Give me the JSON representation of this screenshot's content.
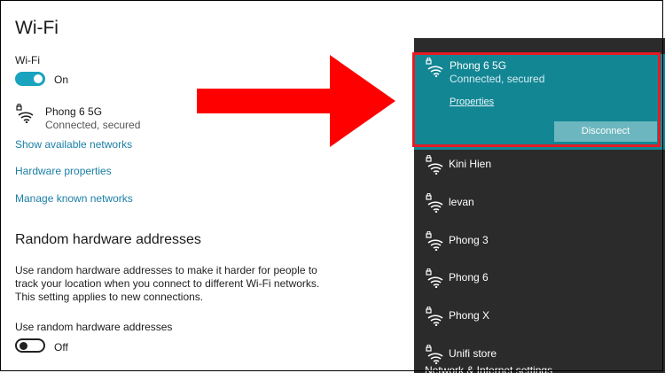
{
  "settings": {
    "page_title": "Wi-Fi",
    "wifi_label": "Wi-Fi",
    "wifi_toggle_state": "On",
    "current_network": {
      "name": "Phong 6 5G",
      "status": "Connected, secured",
      "icon": "wifi-secured-icon"
    },
    "links": {
      "show_networks": "Show available networks",
      "hardware_properties": "Hardware properties",
      "manage_networks": "Manage known networks"
    },
    "random_section": {
      "title": "Random hardware addresses",
      "description": "Use random hardware addresses to make it harder for people to track your location when you connect to different Wi-Fi networks. This setting applies to new connections.",
      "toggle_label": "Use random hardware addresses",
      "toggle_state": "Off"
    }
  },
  "flyout": {
    "active_network": {
      "name": "Phong 6 5G",
      "status": "Connected, secured",
      "properties_label": "Properties",
      "disconnect_label": "Disconnect"
    },
    "networks": [
      {
        "name": "Kini Hien"
      },
      {
        "name": "levan"
      },
      {
        "name": "Phong 3"
      },
      {
        "name": "Phong 6"
      },
      {
        "name": "Phong X"
      },
      {
        "name": "Unifi store"
      }
    ],
    "cut_off_text": "Network & Internet settings"
  },
  "colors": {
    "accent": "#1aa3bf",
    "link": "#1b7fa6",
    "flyout_bg": "#2b2b2b",
    "active_card": "#138694",
    "highlight_border": "#e41b23",
    "arrow": "#ff0000"
  }
}
